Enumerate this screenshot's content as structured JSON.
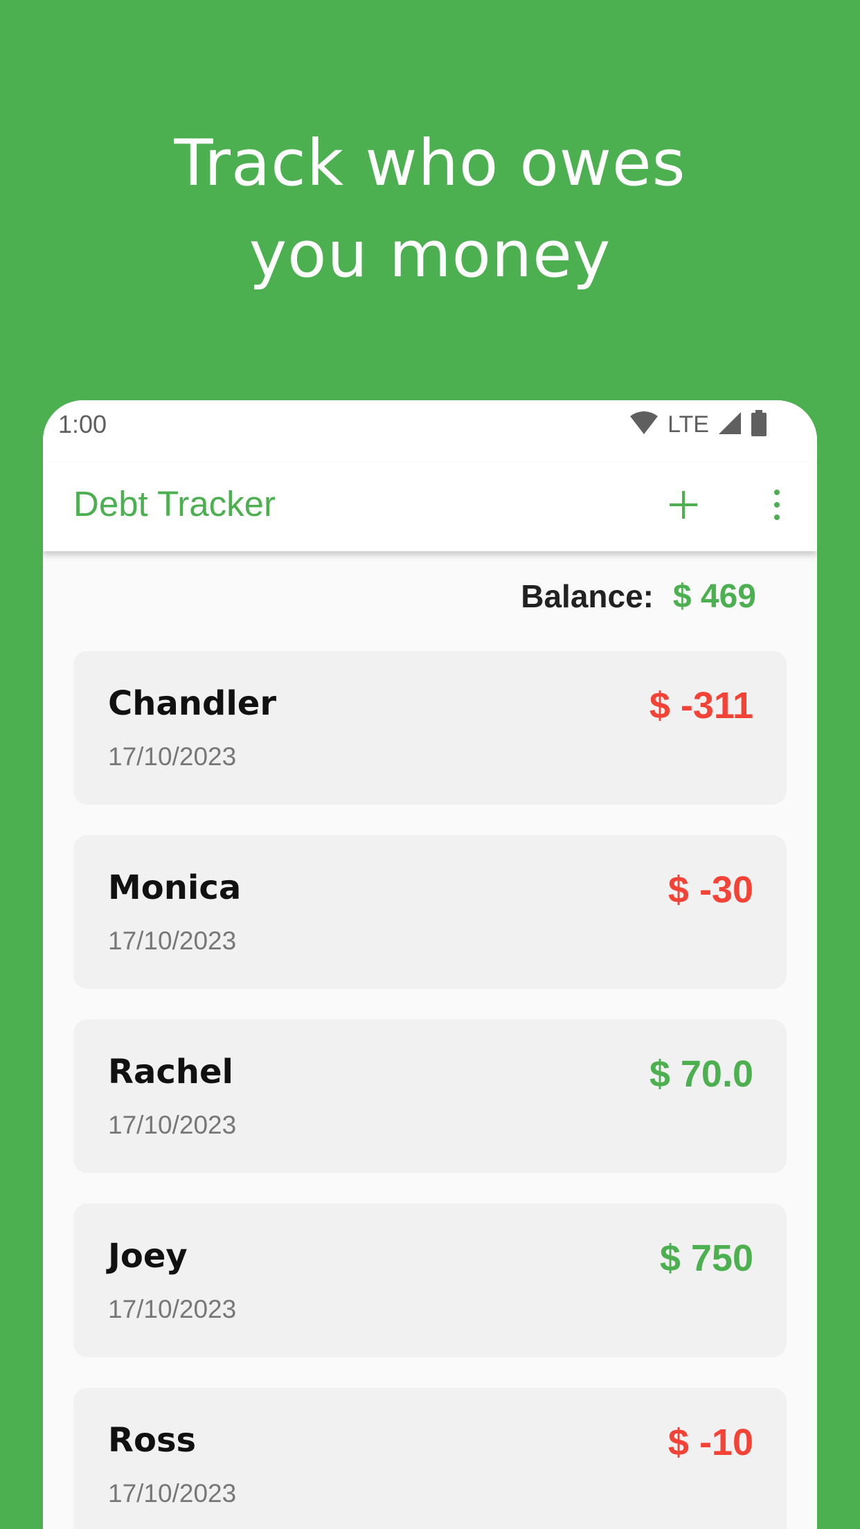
{
  "headline": {
    "line1": "Track who owes",
    "line2": "you money"
  },
  "status_bar": {
    "time": "1:00",
    "network": "LTE"
  },
  "app_bar": {
    "title": "Debt Tracker"
  },
  "balance": {
    "label": "Balance:",
    "value": "$ 469"
  },
  "debts": [
    {
      "name": "Chandler",
      "date": "17/10/2023",
      "amount": "$ -311",
      "status": "negative"
    },
    {
      "name": "Monica",
      "date": "17/10/2023",
      "amount": "$ -30",
      "status": "negative"
    },
    {
      "name": "Rachel",
      "date": "17/10/2023",
      "amount": "$ 70.0",
      "status": "positive"
    },
    {
      "name": "Joey",
      "date": "17/10/2023",
      "amount": "$ 750",
      "status": "positive"
    },
    {
      "name": "Ross",
      "date": "17/10/2023",
      "amount": "$ -10",
      "status": "negative"
    }
  ],
  "colors": {
    "brand_green": "#4caf50",
    "positive": "#4caf50",
    "negative": "#f44336",
    "card_bg": "#f1f1f1",
    "screen_bg": "#fafafa"
  },
  "icons": [
    "wifi-icon",
    "signal-icon",
    "battery-icon",
    "add-icon",
    "more-vert-icon"
  ]
}
